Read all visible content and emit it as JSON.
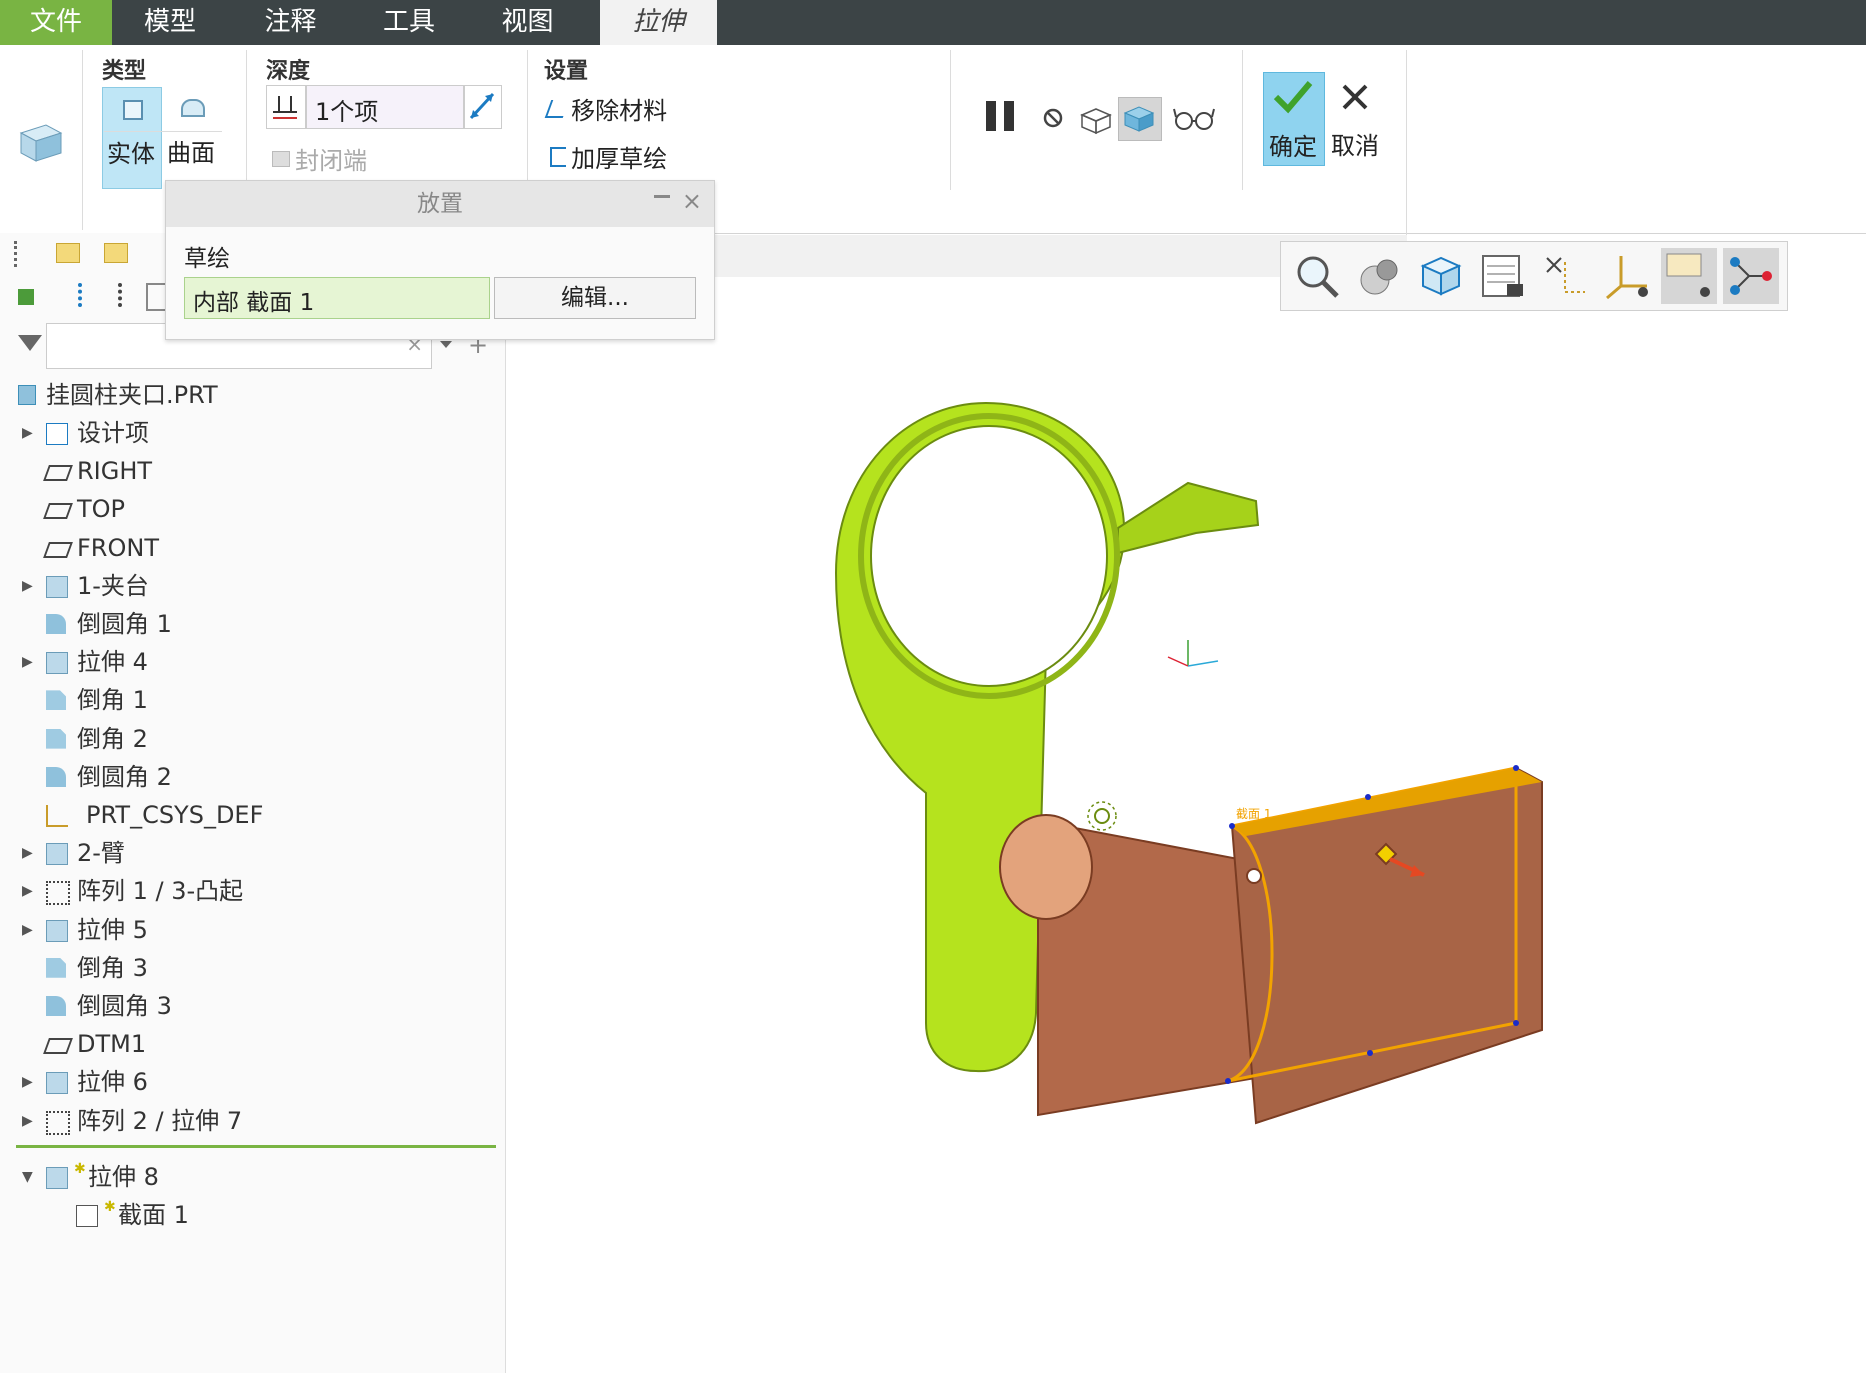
{
  "menubar": {
    "tabs": [
      {
        "label": "文件"
      },
      {
        "label": "模型"
      },
      {
        "label": "注释"
      },
      {
        "label": "工具"
      },
      {
        "label": "视图"
      },
      {
        "label": "拉伸"
      }
    ]
  },
  "ribbon": {
    "type_group": {
      "title": "类型",
      "solid": "实体",
      "surface": "曲面"
    },
    "depth_group": {
      "title": "深度",
      "value": "1个项",
      "capped_ends": "封闭端"
    },
    "settings_group": {
      "title": "设置",
      "remove_material": "移除材料",
      "thicken_sketch": "加厚草绘"
    },
    "confirm": "确定",
    "cancel": "取消"
  },
  "placement_panel": {
    "title": "放置",
    "sketch_label": "草绘",
    "sketch_value": "内部 截面 1",
    "edit_button": "编辑..."
  },
  "model_tree": {
    "root": "挂圆柱夹口.PRT",
    "items": [
      {
        "label": "设计项",
        "icon": "design-items-icon",
        "expandable": true
      },
      {
        "label": "RIGHT",
        "icon": "datum-plane-icon",
        "expandable": false
      },
      {
        "label": "TOP",
        "icon": "datum-plane-icon",
        "expandable": false
      },
      {
        "label": "FRONT",
        "icon": "datum-plane-icon",
        "expandable": false
      },
      {
        "label": "1-夹台",
        "icon": "extrude-icon",
        "expandable": true
      },
      {
        "label": "倒圆角 1",
        "icon": "round-icon",
        "expandable": false
      },
      {
        "label": "拉伸 4",
        "icon": "extrude-icon",
        "expandable": true
      },
      {
        "label": "倒角 1",
        "icon": "chamfer-icon",
        "expandable": false
      },
      {
        "label": "倒角 2",
        "icon": "chamfer-icon",
        "expandable": false
      },
      {
        "label": "倒圆角 2",
        "icon": "round-icon",
        "expandable": false
      },
      {
        "label": "PRT_CSYS_DEF",
        "icon": "csys-icon",
        "expandable": false
      },
      {
        "label": "2-臂",
        "icon": "extrude-icon",
        "expandable": true
      },
      {
        "label": "阵列 1 / 3-凸起",
        "icon": "pattern-icon",
        "expandable": true
      },
      {
        "label": "拉伸 5",
        "icon": "extrude-icon",
        "expandable": true
      },
      {
        "label": "倒角 3",
        "icon": "chamfer-icon",
        "expandable": false
      },
      {
        "label": "倒圆角 3",
        "icon": "round-icon",
        "expandable": false
      },
      {
        "label": "DTM1",
        "icon": "datum-plane-icon",
        "expandable": false
      },
      {
        "label": "拉伸 6",
        "icon": "extrude-icon",
        "expandable": true
      },
      {
        "label": "阵列 2 / 拉伸 7",
        "icon": "pattern-icon",
        "expandable": true
      }
    ],
    "active_feature": "拉伸 8",
    "active_child": "截面 1"
  },
  "colors": {
    "part_green": "#b5e31e",
    "extrude_preview": "#b2694a",
    "accent_orange": "#f2a300",
    "confirm_bg": "#8fd3ef"
  },
  "sketch_preview_label": "截面 1"
}
